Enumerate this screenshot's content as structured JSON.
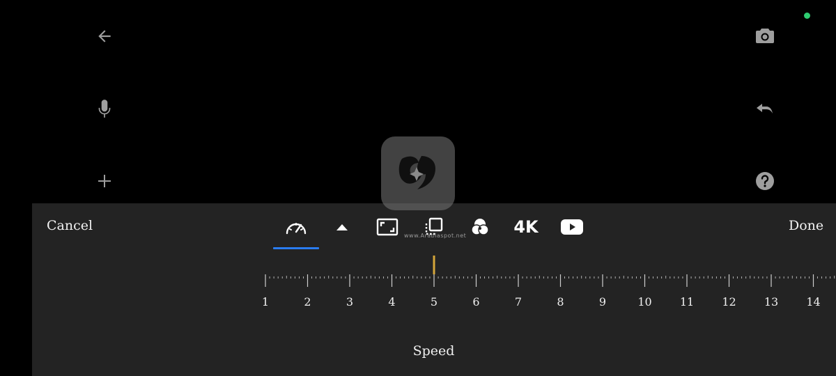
{
  "colors": {
    "background": "#000000",
    "panel": "#232323",
    "icon_gray": "#9e9e9e",
    "accent_blue": "#2a7cf0",
    "indicator_gold": "#d4a63a",
    "status_green": "#2ecc71"
  },
  "left_rail": [
    {
      "icon": "back-arrow-icon"
    },
    {
      "icon": "microphone-icon"
    },
    {
      "icon": "plus-icon"
    }
  ],
  "right_rail": [
    {
      "icon": "camera-icon"
    },
    {
      "icon": "undo-icon"
    },
    {
      "icon": "help-icon"
    }
  ],
  "watermark": "www.Arabiaspot.net",
  "panel": {
    "cancel_label": "Cancel",
    "done_label": "Done",
    "tools": [
      {
        "icon": "speedometer-icon",
        "active": true
      },
      {
        "icon": "triangle-up-icon"
      },
      {
        "icon": "aspect-ratio-icon"
      },
      {
        "icon": "layers-icon"
      },
      {
        "icon": "color-filter-icon"
      },
      {
        "label": "4K"
      },
      {
        "icon": "youtube-icon"
      }
    ],
    "ruler": {
      "ticks": [
        "1",
        "2",
        "3",
        "4",
        "5",
        "6",
        "7",
        "8",
        "9",
        "10",
        "11",
        "12",
        "13",
        "14"
      ],
      "current_value": 5
    },
    "mode_label": "Speed"
  }
}
